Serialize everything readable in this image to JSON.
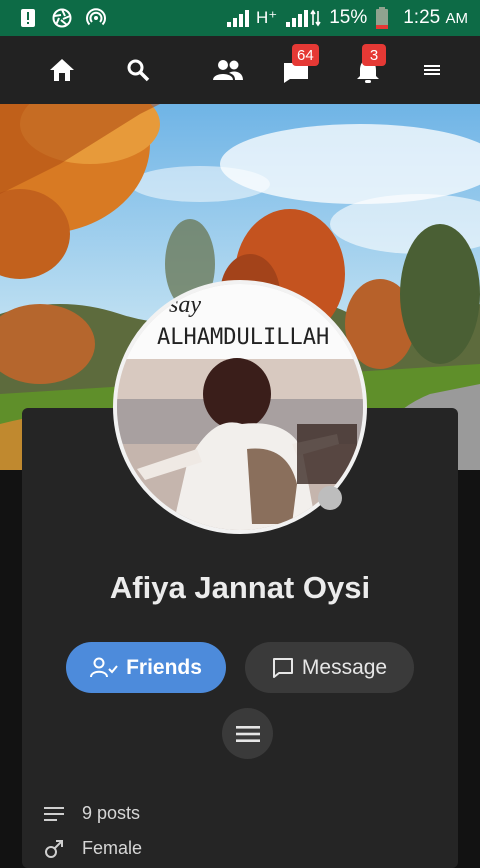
{
  "status_bar": {
    "network": "H⁺",
    "battery": "15%",
    "time": "1:25",
    "ampm": "AM"
  },
  "nav": {
    "messages_badge": "64",
    "notifications_badge": "3"
  },
  "cover": {
    "text_line1": "and say",
    "text_line2": "ALHAMDULILLAH"
  },
  "profile": {
    "name": "Afiya Jannat Oysi",
    "friends_label": "Friends",
    "message_label": "Message"
  },
  "info": {
    "posts": "9 posts",
    "gender": "Female"
  },
  "colors": {
    "status_bar": "#0d6b46",
    "nav_bg": "#222222",
    "accent": "#4d8bdb",
    "badge": "#e53935"
  }
}
